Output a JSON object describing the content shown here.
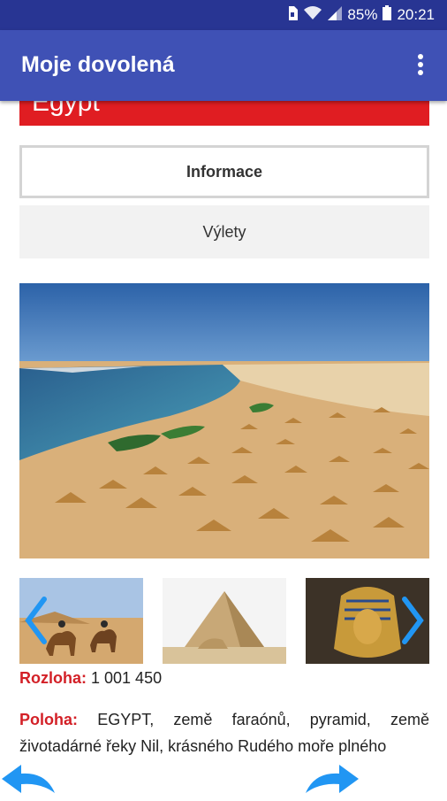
{
  "status": {
    "battery_percent": "85%",
    "time": "20:21"
  },
  "app": {
    "title": "Moje dovolená"
  },
  "country": {
    "name": "Egypt"
  },
  "tabs": {
    "info_label": "Informace",
    "trips_label": "Výlety"
  },
  "details": {
    "area_label": "Rozloha:",
    "area_value": "1 001 450",
    "location_label": "Poloha:",
    "location_text": "EGYPT, země faraónů, pyramid, země životadárné řeky Nil, krásného Rudého moře plného"
  },
  "colors": {
    "statusbar": "#283593",
    "appbar": "#3f51b5",
    "banner": "#e01d22",
    "label_red": "#d32027",
    "nav_blue": "#2196f3"
  },
  "icons": [
    "sim-icon",
    "wifi-icon",
    "signal-icon",
    "battery-icon",
    "more-vert-icon",
    "chevron-left-icon",
    "chevron-right-icon",
    "undo-arrow-icon",
    "redo-arrow-icon"
  ]
}
